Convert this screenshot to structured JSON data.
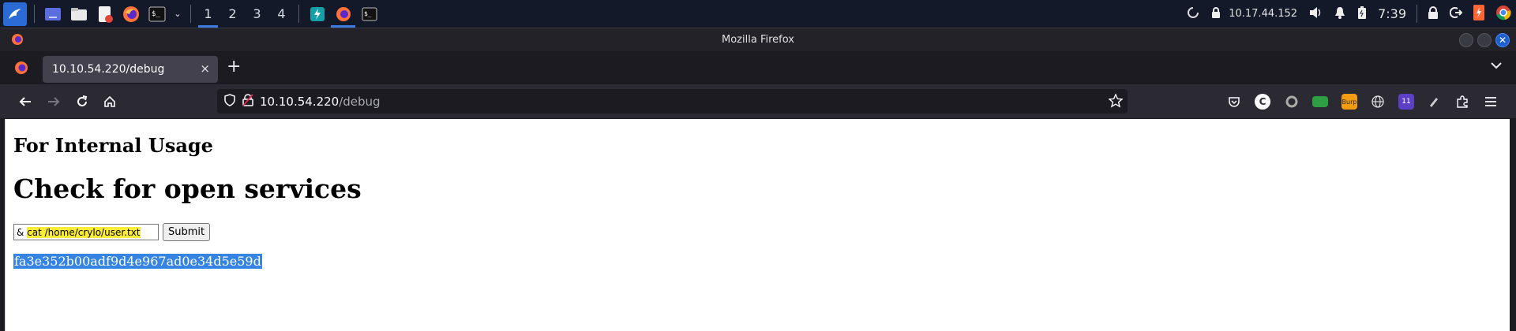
{
  "taskbar": {
    "workspaces": [
      "1",
      "2",
      "3",
      "4"
    ],
    "ip": "10.17.44.152",
    "clock": "7:39"
  },
  "window": {
    "title": "Mozilla Firefox"
  },
  "browser": {
    "tab_title": "10.10.54.220/debug",
    "tab_close": "×",
    "new_tab": "+",
    "url_host": "10.10.54.220",
    "url_path": "/debug",
    "ext_badge_burp": "Burp",
    "ext_badge_count": "11"
  },
  "page": {
    "subtitle": "For Internal Usage",
    "heading": "Check for open services",
    "input_prefix": "& ",
    "input_command": "cat /home/crylo/user.txt",
    "submit_label": "Submit",
    "output": "fa3e352b00adf9d4e967ad0e34d5e59d"
  },
  "colors": {
    "accent": "#3d7be0",
    "selection": "#3584e4",
    "highlight": "#fbec37"
  }
}
